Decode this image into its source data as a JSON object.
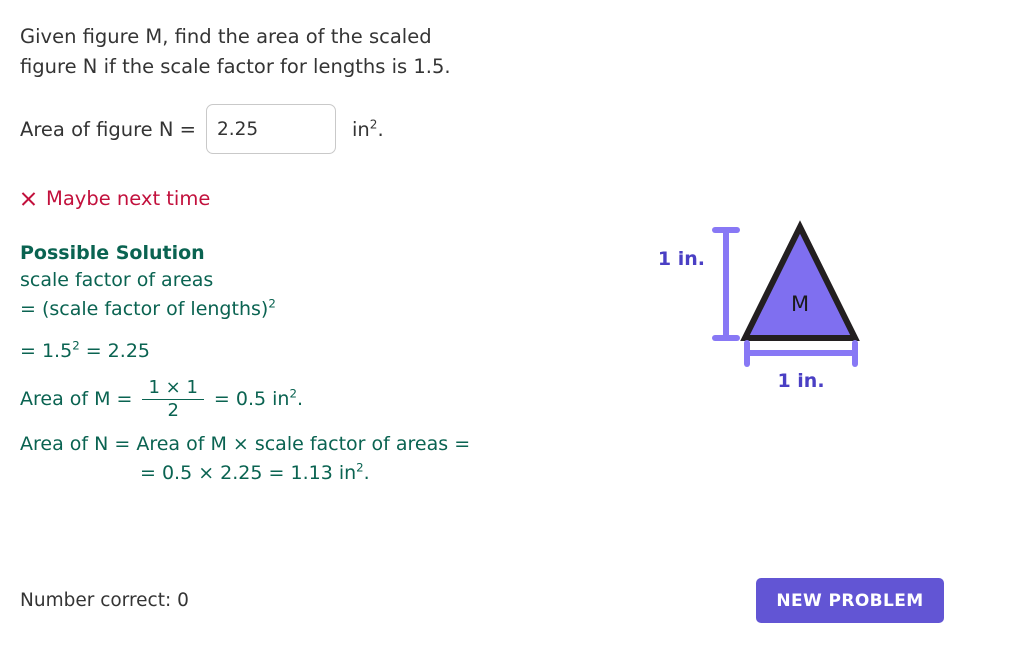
{
  "problem": {
    "prompt_line1": "Given figure M, find the area of the scaled",
    "prompt_line2": "figure N if the scale factor for lengths is 1.5.",
    "answer_label": "Area of figure N  =",
    "answer_value": "2.25",
    "answer_placeholder": "",
    "unit_base": "in",
    "unit_exponent": "2",
    "unit_period": "."
  },
  "feedback": {
    "icon": "x-mark-icon",
    "text": "Maybe next time",
    "color": "#c2103c"
  },
  "solution": {
    "title": "Possible Solution",
    "color": "#0a6351",
    "line1": "scale factor of areas",
    "line2_prefix": "=  (scale factor of lengths)",
    "line2_exponent": "2",
    "line3_prefix": "=  1.5",
    "line3_exponent": "2",
    "line3_suffix": "  =  2.25",
    "area_m_label": "Area of M  =",
    "area_m_numerator": "1  ×  1",
    "area_m_denominator": "2",
    "area_m_result_prefix": "=  0.5  in",
    "area_m_result_exponent": "2",
    "area_m_result_suffix": ".",
    "area_n_line": "Area of N  =  Area of M  ×  scale factor of areas  =",
    "area_n_result_prefix": "=  0.5  ×  2.25  =  1.13  in",
    "area_n_result_exponent": "2",
    "area_n_result_suffix": "."
  },
  "figure": {
    "shape_label": "M",
    "fill_color": "#7f6ff0",
    "stroke_color": "#231f20",
    "dimension_color": "#8878f5",
    "dimension_text_color": "#4a3fc4",
    "height_label": "1 in.",
    "width_label": "1 in."
  },
  "footer": {
    "score_text": "Number correct: 0",
    "new_problem_label": "NEW PROBLEM",
    "button_color": "#6255d4"
  }
}
